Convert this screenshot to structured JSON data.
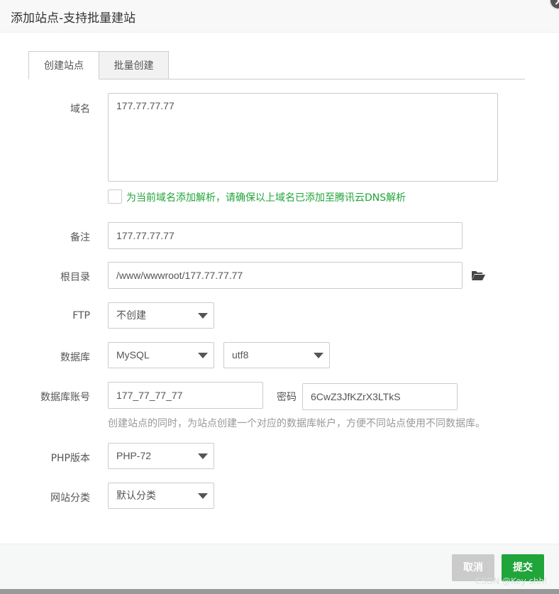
{
  "dialog": {
    "title": "添加站点-支持批量建站"
  },
  "tabs": [
    {
      "label": "创建站点",
      "active": true
    },
    {
      "label": "批量创建",
      "active": false
    }
  ],
  "form": {
    "domain": {
      "label": "域名",
      "value": "177.77.77.77"
    },
    "dns_checkbox": {
      "label": "为当前域名添加解析，请确保以上域名已添加至腾讯云DNS解析",
      "checked": false
    },
    "remark": {
      "label": "备注",
      "value": "177.77.77.77"
    },
    "root": {
      "label": "根目录",
      "value": "/www/wwwroot/177.77.77.77"
    },
    "ftp": {
      "label": "FTP",
      "value": "不创建"
    },
    "database": {
      "label": "数据库",
      "type": "MySQL",
      "charset": "utf8"
    },
    "db_account": {
      "label": "数据库账号",
      "value": "177_77_77_77",
      "password_label": "密码",
      "password": "6CwZ3JfKZrX3LTkS"
    },
    "db_hint": "创建站点的同时，为站点创建一个对应的数据库帐户，方便不同站点使用不同数据库。",
    "php": {
      "label": "PHP版本",
      "value": "PHP-72"
    },
    "category": {
      "label": "网站分类",
      "value": "默认分类"
    }
  },
  "footer": {
    "cancel_label": "取消",
    "submit_label": "提交"
  },
  "watermark": "CSDN @Key shh!",
  "colors": {
    "accent_green": "#20a53a",
    "cancel_gray": "#cbcbcb"
  }
}
